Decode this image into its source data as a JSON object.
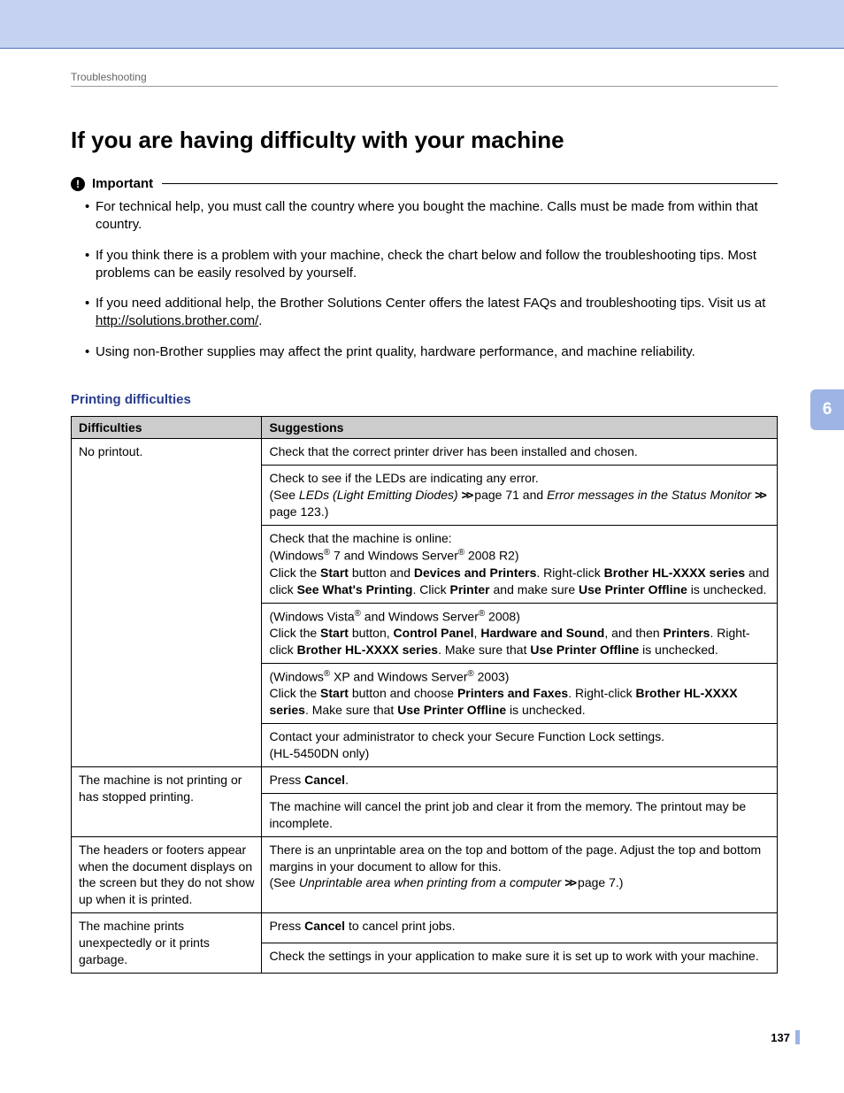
{
  "header": {
    "breadcrumb": "Troubleshooting"
  },
  "page": {
    "title": "If you are having difficulty with your machine",
    "chapter_tab": "6",
    "page_number": "137"
  },
  "important": {
    "label": "Important",
    "bullets": {
      "b1": "For technical help, you must call the country where you bought the machine. Calls must be made from within that country.",
      "b2": "If you think there is a problem with your machine, check the chart below and follow the troubleshooting tips. Most problems can be easily resolved by yourself.",
      "b3a": "If you need additional help, the Brother Solutions Center offers the latest FAQs and troubleshooting tips. Visit us at ",
      "b3_link": "http://solutions.brother.com/",
      "b3b": ".",
      "b4": "Using non-Brother supplies may affect the print quality, hardware performance, and machine reliability."
    }
  },
  "section": {
    "heading": "Printing difficulties"
  },
  "table": {
    "headers": {
      "col1": "Difficulties",
      "col2": "Suggestions"
    },
    "row1": {
      "difficulty": "No printout.",
      "s1": "Check that the correct printer driver has been installed and chosen.",
      "s2": {
        "a": "Check to see if the LEDs are indicating any error.",
        "b": "(See ",
        "c_i": "LEDs (Light Emitting Diodes)",
        "d": " ",
        "e": " page 71 and ",
        "f_i": "Error messages in the Status Monitor",
        "g": " ",
        "h": " page 123.)"
      },
      "s3": {
        "a": "Check that the machine is online:",
        "b1": "(Windows",
        "b2": " 7 and Windows Server",
        "b3": " 2008 R2)",
        "c1": "Click the ",
        "c2_b": "Start",
        "c3": " button and ",
        "c4_b": "Devices and Printers",
        "c5": ". Right-click ",
        "c6_b": "Brother HL-XXXX series",
        "c7": " and click ",
        "c8_b": "See What's Printing",
        "c9": ". Click ",
        "c10_b": "Printer",
        "c11": " and make sure ",
        "c12_b": "Use Printer Offline",
        "c13": " is unchecked."
      },
      "s4": {
        "a1": "(Windows Vista",
        "a2": " and Windows Server",
        "a3": " 2008)",
        "b1": "Click the ",
        "b2_b": "Start",
        "b3": " button, ",
        "b4_b": "Control Panel",
        "b5": ", ",
        "b6_b": "Hardware and Sound",
        "b7": ", and then ",
        "b8_b": "Printers",
        "b9": ". Right-click ",
        "b10_b": "Brother HL-XXXX series",
        "b11": ". Make sure that ",
        "b12_b": "Use Printer Offline",
        "b13": " is unchecked."
      },
      "s5": {
        "a1": "(Windows",
        "a2": " XP and Windows Server",
        "a3": " 2003)",
        "b1": "Click the ",
        "b2_b": "Start",
        "b3": " button and choose ",
        "b4_b": "Printers and Faxes",
        "b5": ". Right-click ",
        "b6_b": "Brother HL-XXXX series",
        "b7": ". Make sure that ",
        "b8_b": "Use Printer Offline",
        "b9": " is unchecked."
      },
      "s6": {
        "a": "Contact your administrator to check your Secure Function Lock settings.",
        "b": "(HL-5450DN only)"
      }
    },
    "row2": {
      "difficulty": "The machine is not printing or has stopped printing.",
      "s1": {
        "a": "Press ",
        "b_b": "Cancel",
        "c": "."
      },
      "s2": "The machine will cancel the print job and clear it from the memory. The printout may be incomplete."
    },
    "row3": {
      "difficulty": "The headers or footers appear when the document displays on the screen but they do not show up when it is printed.",
      "s1": {
        "a": "There is an unprintable area on the top and bottom of the page. Adjust the top and bottom margins in your document to allow for this.",
        "b": "(See ",
        "c_i": "Unprintable area when printing from a computer",
        "d": " ",
        "e": " page 7.)"
      }
    },
    "row4": {
      "difficulty": "The machine prints unexpectedly or it prints garbage.",
      "s1": {
        "a": "Press ",
        "b_b": "Cancel",
        "c": " to cancel print jobs."
      },
      "s2": "Check the settings in your application to make sure it is set up to work with your machine."
    }
  }
}
